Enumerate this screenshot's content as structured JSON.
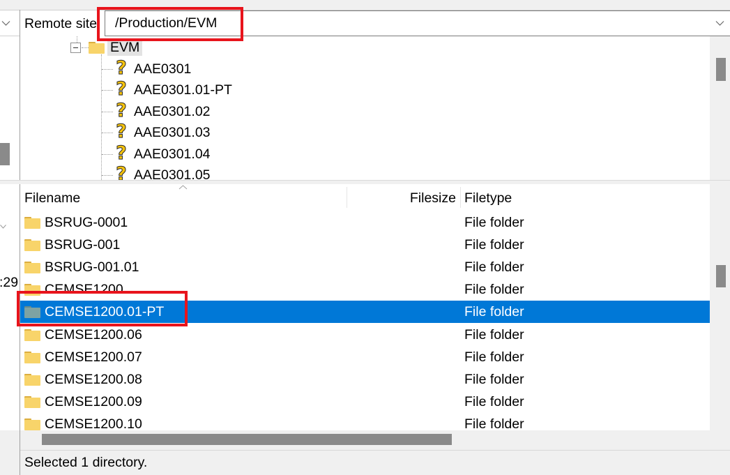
{
  "colors": {
    "selection": "#0078d7",
    "annotation_box": "#e8141c",
    "folder": "#f8d46a",
    "unknown_item_icon": "#f4c20d"
  },
  "local_pane": {
    "site_dropdown_icon": "chevron-down-icon",
    "visible_fragment": ":29"
  },
  "remote_site": {
    "label": "Remote site:",
    "path": "/Production/EVM",
    "dropdown_icon": "chevron-down-icon"
  },
  "remote_tree": {
    "node": {
      "label": "EVM",
      "icon": "folder-icon",
      "expander_icon": "collapse-minus-icon"
    },
    "children": [
      {
        "label": "AAE0301",
        "icon": "question-mark-icon"
      },
      {
        "label": "AAE0301.01-PT",
        "icon": "question-mark-icon"
      },
      {
        "label": "AAE0301.02",
        "icon": "question-mark-icon"
      },
      {
        "label": "AAE0301.03",
        "icon": "question-mark-icon"
      },
      {
        "label": "AAE0301.04",
        "icon": "question-mark-icon"
      },
      {
        "label": "AAE0301.05",
        "icon": "question-mark-icon"
      }
    ]
  },
  "file_list": {
    "columns": {
      "filename": "Filename",
      "filesize": "Filesize",
      "filetype": "Filetype"
    },
    "sort_icon": "sort-ascending-icon",
    "rows": [
      {
        "name": "BSRUG-0001",
        "type": "File folder",
        "icon": "folder-icon",
        "selected": false
      },
      {
        "name": "BSRUG-001",
        "type": "File folder",
        "icon": "folder-icon",
        "selected": false
      },
      {
        "name": "BSRUG-001.01",
        "type": "File folder",
        "icon": "folder-icon",
        "selected": false
      },
      {
        "name": "CEMSE1200",
        "type": "File folder",
        "icon": "folder-icon",
        "selected": false
      },
      {
        "name": "CEMSE1200.01-PT",
        "type": "File folder",
        "icon": "folder-icon",
        "selected": true
      },
      {
        "name": "CEMSE1200.06",
        "type": "File folder",
        "icon": "folder-icon",
        "selected": false
      },
      {
        "name": "CEMSE1200.07",
        "type": "File folder",
        "icon": "folder-icon",
        "selected": false
      },
      {
        "name": "CEMSE1200.08",
        "type": "File folder",
        "icon": "folder-icon",
        "selected": false
      },
      {
        "name": "CEMSE1200.09",
        "type": "File folder",
        "icon": "folder-icon",
        "selected": false
      },
      {
        "name": "CEMSE1200.10",
        "type": "File folder",
        "icon": "folder-icon",
        "selected": false
      }
    ]
  },
  "status_bar": {
    "text": "Selected 1 directory."
  }
}
